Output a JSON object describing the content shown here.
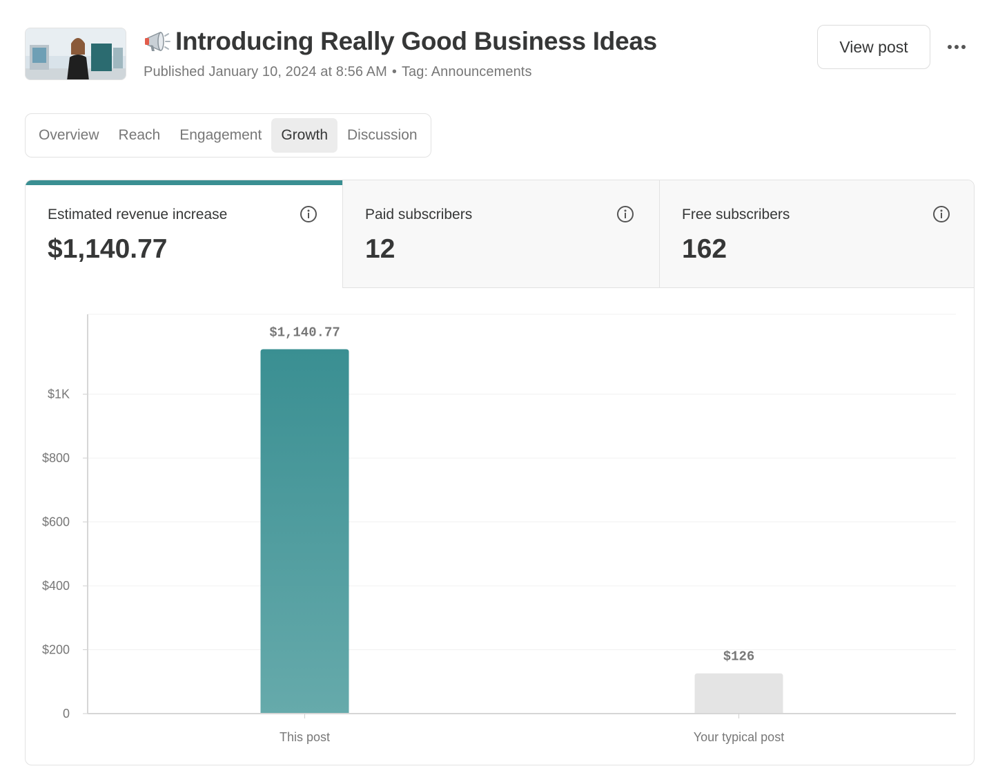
{
  "post": {
    "title": "Introducing Really Good Business Ideas",
    "emoji_icon": "megaphone-icon",
    "published": "Published January 10, 2024 at 8:56 AM",
    "separator": "•",
    "tag": "Tag: Announcements"
  },
  "actions": {
    "view_post": "View post",
    "more_icon": "more-horizontal-icon"
  },
  "tabs": [
    {
      "label": "Overview",
      "active": false
    },
    {
      "label": "Reach",
      "active": false
    },
    {
      "label": "Engagement",
      "active": false
    },
    {
      "label": "Growth",
      "active": true
    },
    {
      "label": "Discussion",
      "active": false
    }
  ],
  "stats": [
    {
      "label": "Estimated revenue increase",
      "value": "$1,140.77",
      "selected": true
    },
    {
      "label": "Paid subscribers",
      "value": "12",
      "selected": false
    },
    {
      "label": "Free subscribers",
      "value": "162",
      "selected": false
    }
  ],
  "colors": {
    "accent": "#3a8f92",
    "bar_primary_top": "#3a8f92",
    "bar_primary_bottom": "#66aaab",
    "bar_secondary": "#e4e4e4"
  },
  "chart_data": {
    "type": "bar",
    "categories": [
      "This post",
      "Your typical post"
    ],
    "values": [
      1140.77,
      126
    ],
    "data_labels": [
      "$1,140.77",
      "$126"
    ],
    "ylim": [
      0,
      1250
    ],
    "yticks": [
      0,
      200,
      400,
      600,
      800,
      1000
    ],
    "ytick_labels": [
      "0",
      "$200",
      "$400",
      "$600",
      "$800",
      "$1K"
    ],
    "grid": true
  }
}
